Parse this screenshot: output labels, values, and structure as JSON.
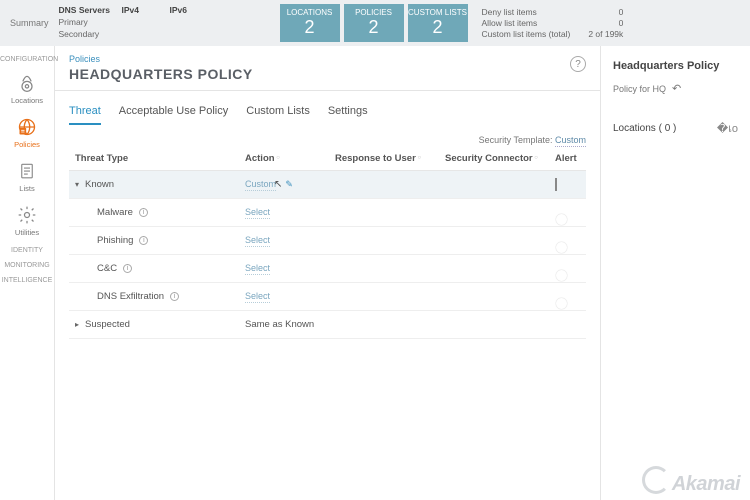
{
  "topbar": {
    "summary": "Summary",
    "dns": {
      "servers": "DNS Servers",
      "primary": "Primary",
      "secondary": "Secondary",
      "ipv4": "IPv4",
      "ipv6": "IPv6"
    },
    "metrics": [
      {
        "label": "LOCATIONS",
        "value": "2"
      },
      {
        "label": "POLICIES",
        "value": "2"
      },
      {
        "label": "CUSTOM LISTS",
        "value": "2"
      }
    ],
    "lists": {
      "deny_label": "Deny list items",
      "deny_val": "0",
      "allow_label": "Allow list items",
      "allow_val": "0",
      "custom_label": "Custom list items (total)",
      "custom_val": "2 of 199k"
    }
  },
  "sidebar": {
    "section1": "CONFIGURATION",
    "items": [
      {
        "label": "Locations"
      },
      {
        "label": "Policies"
      },
      {
        "label": "Lists"
      },
      {
        "label": "Utilities"
      }
    ],
    "section2": "IDENTITY",
    "section3": "MONITORING",
    "section4": "INTELLIGENCE"
  },
  "page": {
    "breadcrumb": "Policies",
    "title": "HEADQUARTERS POLICY",
    "help": "?"
  },
  "tabs": [
    "Threat",
    "Acceptable Use Policy",
    "Custom Lists",
    "Settings"
  ],
  "security_template": {
    "label": "Security Template:",
    "value": "Custom"
  },
  "columns": {
    "type": "Threat Type",
    "action": "Action",
    "response": "Response to User",
    "connector": "Security Connector",
    "alert": "Alert"
  },
  "rows": {
    "known": {
      "name": "Known",
      "action": "Custom"
    },
    "malware": {
      "name": "Malware",
      "action": "Select"
    },
    "phishing": {
      "name": "Phishing",
      "action": "Select"
    },
    "cc": {
      "name": "C&C",
      "action": "Select"
    },
    "dnsex": {
      "name": "DNS Exfiltration",
      "action": "Select"
    },
    "suspected": {
      "name": "Suspected",
      "action": "Same as Known"
    }
  },
  "rpanel": {
    "title": "Headquarters Policy",
    "desc": "Policy for HQ",
    "loc_label": "Locations ( 0 )"
  },
  "brand": "Akamai"
}
